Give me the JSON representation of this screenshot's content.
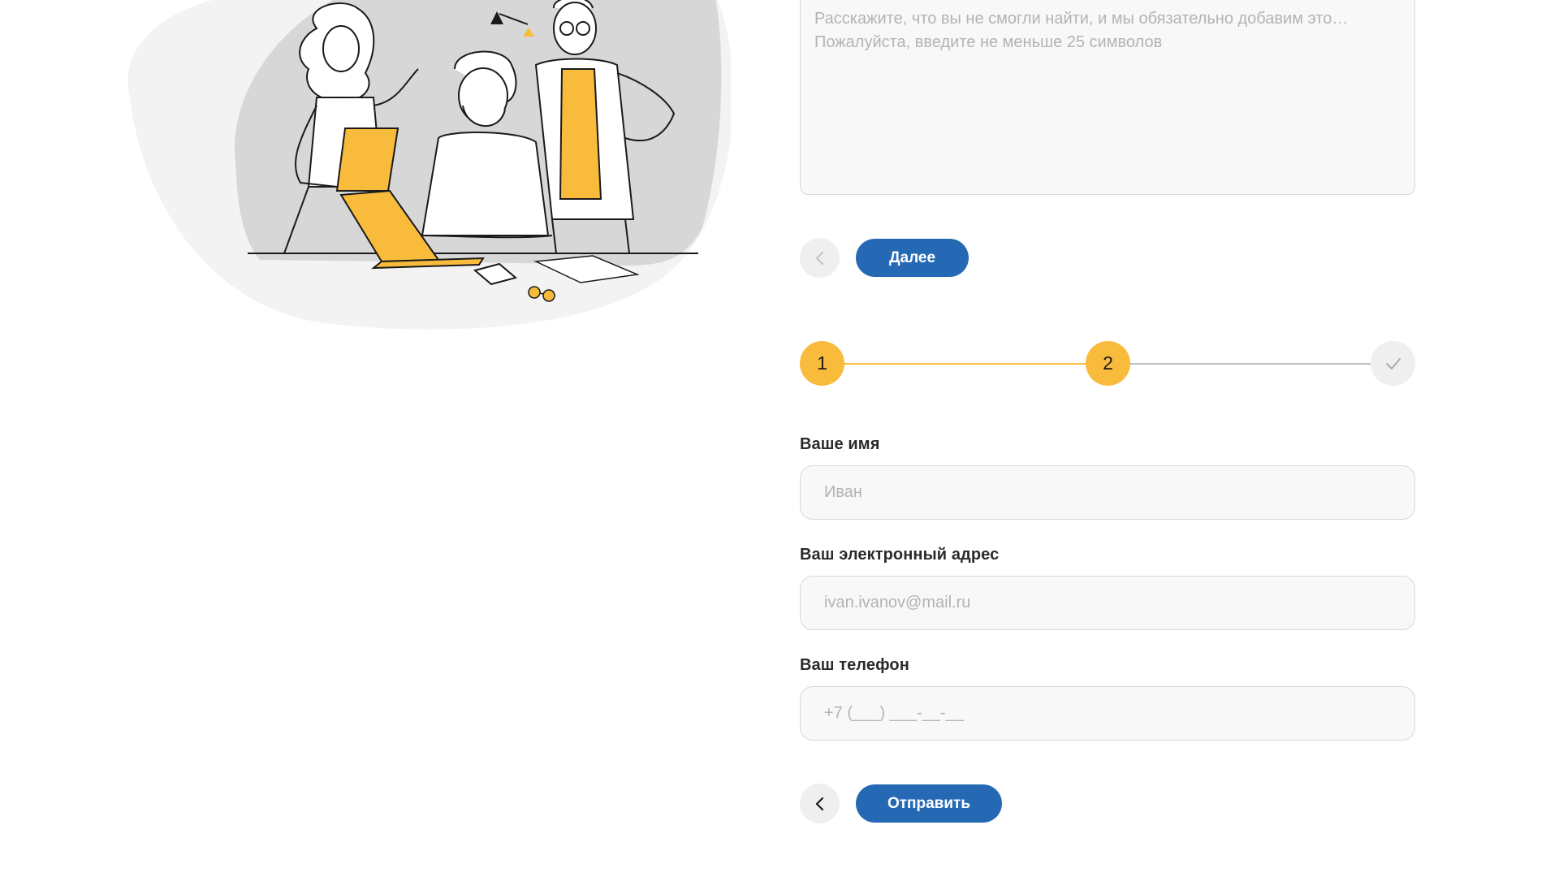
{
  "step1": {
    "question": {
      "placeholder": "Расскажите, что вы не смогли найти, и мы обязательно добавим это…\nПожалуйста, введите не меньше 25 символов",
      "value": ""
    },
    "back_icon": "chevron-left-icon",
    "next_label": "Далее"
  },
  "stepper": {
    "steps": [
      {
        "label": "1",
        "state": "done"
      },
      {
        "label": "2",
        "state": "current"
      },
      {
        "label": "",
        "icon": "check-icon",
        "state": "pending"
      }
    ],
    "colors": {
      "active": "#f9bb3c",
      "inactive": "#efefef",
      "line_done": "#f7bc3c",
      "line_pending": "#bdbdbd"
    }
  },
  "step2": {
    "fields": {
      "name": {
        "label": "Ваше имя",
        "placeholder": "Иван",
        "value": ""
      },
      "email": {
        "label": "Ваш электронный адрес",
        "placeholder": "ivan.ivanov@mail.ru",
        "value": ""
      },
      "phone": {
        "label": "Ваш телефон",
        "placeholder": "+7 (___) ___-__-__",
        "value": ""
      }
    },
    "back_icon": "chevron-left-icon",
    "submit_label": "Отправить"
  },
  "colors": {
    "primary": "#2569b5",
    "accent": "#f9bb3c",
    "field_bg": "#f8f8f8",
    "field_border": "#d9d9d9"
  }
}
